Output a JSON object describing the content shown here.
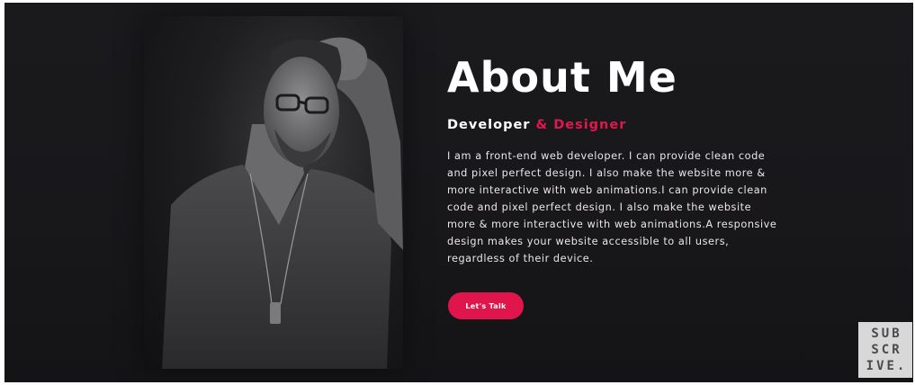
{
  "about": {
    "title": "About Me",
    "subtitle_part1": "Developer",
    "subtitle_part2": "& Designer",
    "bio": "I am a front-end web developer. I can provide clean code and pixel perfect design. I also make the website more & more interactive with web animations.I can provide clean code and pixel perfect design. I also make the website more & more interactive with web animations.A responsive design makes your website accessible to all users, regardless of their device.",
    "cta_label": "Let's Talk"
  },
  "subscribe_badge": {
    "line1": "SUB",
    "line2": "SCR",
    "line3": "IVE."
  },
  "colors": {
    "background": "#18181b",
    "accent": "#e3164e",
    "text": "#ffffff"
  },
  "icons": {
    "photo": "profile-portrait-image"
  }
}
